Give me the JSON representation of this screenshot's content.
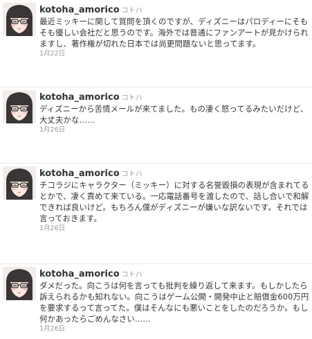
{
  "tweets": [
    {
      "username": "kotoha_amorico",
      "fullname": "コトハ",
      "text": "最近ミッキーに関して質問を頂くのですが、ディズニーはパロディーにそもそも優しい会社だと思うのです。海外では普通にファンアートが見かけられますし、著作権が切れた日本では尚更問題ないと思ってます。",
      "date": "1月22日"
    },
    {
      "username": "kotoha_amorico",
      "fullname": "コトハ",
      "text": "ディズニーから苦情メールが来てました。もの凄く怒ってるみたいだけど、大丈夫かな……",
      "date": "1月26日"
    },
    {
      "username": "kotoha_amorico",
      "fullname": "コトハ",
      "text": "チコラジにキャラクター（ミッキー）に対する名誉毀損の表現が含まれてるとかで、凄く責めて来ている。一応電話番号を渡したので、話し合いで和解できれば良いけど。もちろん僕がディズニーが嫌いな訳ないです。それでは言っておきます。",
      "date": "1月26日"
    },
    {
      "username": "kotoha_amorico",
      "fullname": "コトハ",
      "text": "ダメだった。向こうは何を言っても批判を繰り返して来ます。もしかしたら訴えられるかも知れない。向こうはゲーム公開・開発中止と賠償金600万円を要求するって言ってた。僕はそんなにも悪いことをしたのだろうか。もし何かあったらごめんなさい……",
      "date": "1月26日"
    }
  ]
}
